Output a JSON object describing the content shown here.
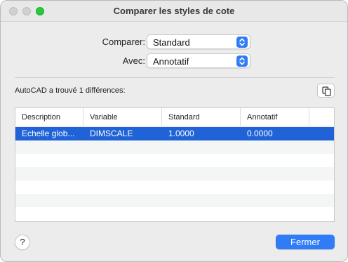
{
  "window": {
    "title": "Comparer les styles de cote"
  },
  "form": {
    "compare_label": "Comparer:",
    "compare_value": "Standard",
    "with_label": "Avec:",
    "with_value": "Annotatif"
  },
  "results": {
    "summary": "AutoCAD a trouvé 1 différences:"
  },
  "table": {
    "columns": [
      "Description",
      "Variable",
      "Standard",
      "Annotatif"
    ],
    "rows": [
      {
        "description": "Echelle glob...",
        "variable": "DIMSCALE",
        "standard": "1.0000",
        "annotatif": "0.0000"
      }
    ]
  },
  "footer": {
    "help_label": "?",
    "close_label": "Fermer"
  },
  "colors": {
    "accent": "#2f7cf6",
    "selection": "#1f63d7",
    "zoom_button": "#28c940"
  },
  "icons": {
    "popup_arrows": "updown-chevron-icon",
    "copy": "copy-clipboard-icon"
  }
}
